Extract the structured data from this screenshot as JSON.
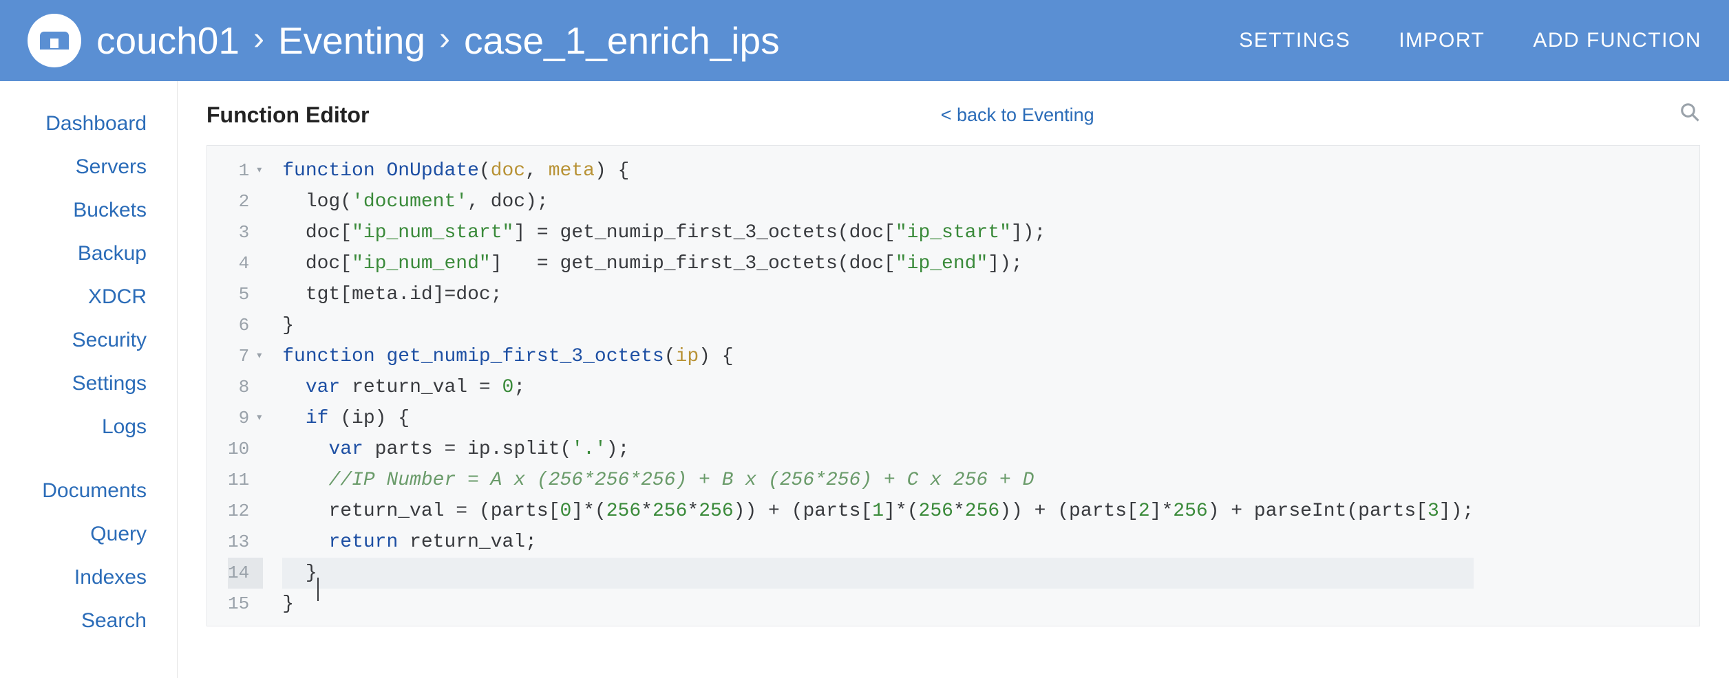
{
  "header": {
    "breadcrumb": [
      "couch01",
      "Eventing",
      "case_1_enrich_ips"
    ],
    "actions": [
      "SETTINGS",
      "IMPORT",
      "ADD FUNCTION"
    ]
  },
  "sidebar": {
    "group1": [
      "Dashboard",
      "Servers",
      "Buckets",
      "Backup",
      "XDCR",
      "Security",
      "Settings",
      "Logs"
    ],
    "group2": [
      "Documents",
      "Query",
      "Indexes",
      "Search"
    ]
  },
  "main": {
    "title": "Function Editor",
    "back_link": "< back to Eventing"
  },
  "editor": {
    "active_line": 14,
    "fold_lines": [
      1,
      7,
      9
    ],
    "lines": [
      [
        {
          "t": "k",
          "v": "function"
        },
        {
          "t": "p",
          "v": " "
        },
        {
          "t": "fn",
          "v": "OnUpdate"
        },
        {
          "t": "p",
          "v": "("
        },
        {
          "t": "arg",
          "v": "doc"
        },
        {
          "t": "p",
          "v": ", "
        },
        {
          "t": "arg",
          "v": "meta"
        },
        {
          "t": "p",
          "v": ") {"
        }
      ],
      [
        {
          "t": "p",
          "v": "  "
        },
        {
          "t": "id",
          "v": "log"
        },
        {
          "t": "p",
          "v": "("
        },
        {
          "t": "s",
          "v": "'document'"
        },
        {
          "t": "p",
          "v": ", "
        },
        {
          "t": "id",
          "v": "doc"
        },
        {
          "t": "p",
          "v": ");"
        }
      ],
      [
        {
          "t": "p",
          "v": "  "
        },
        {
          "t": "id",
          "v": "doc"
        },
        {
          "t": "p",
          "v": "["
        },
        {
          "t": "s",
          "v": "\"ip_num_start\""
        },
        {
          "t": "p",
          "v": "] = "
        },
        {
          "t": "id",
          "v": "get_numip_first_3_octets"
        },
        {
          "t": "p",
          "v": "("
        },
        {
          "t": "id",
          "v": "doc"
        },
        {
          "t": "p",
          "v": "["
        },
        {
          "t": "s",
          "v": "\"ip_start\""
        },
        {
          "t": "p",
          "v": "]);"
        }
      ],
      [
        {
          "t": "p",
          "v": "  "
        },
        {
          "t": "id",
          "v": "doc"
        },
        {
          "t": "p",
          "v": "["
        },
        {
          "t": "s",
          "v": "\"ip_num_end\""
        },
        {
          "t": "p",
          "v": "]   = "
        },
        {
          "t": "id",
          "v": "get_numip_first_3_octets"
        },
        {
          "t": "p",
          "v": "("
        },
        {
          "t": "id",
          "v": "doc"
        },
        {
          "t": "p",
          "v": "["
        },
        {
          "t": "s",
          "v": "\"ip_end\""
        },
        {
          "t": "p",
          "v": "]);"
        }
      ],
      [
        {
          "t": "p",
          "v": "  "
        },
        {
          "t": "id",
          "v": "tgt"
        },
        {
          "t": "p",
          "v": "["
        },
        {
          "t": "id",
          "v": "meta"
        },
        {
          "t": "p",
          "v": "."
        },
        {
          "t": "id",
          "v": "id"
        },
        {
          "t": "p",
          "v": "]="
        },
        {
          "t": "id",
          "v": "doc"
        },
        {
          "t": "p",
          "v": ";"
        }
      ],
      [
        {
          "t": "p",
          "v": "}"
        }
      ],
      [
        {
          "t": "k",
          "v": "function"
        },
        {
          "t": "p",
          "v": " "
        },
        {
          "t": "fn",
          "v": "get_numip_first_3_octets"
        },
        {
          "t": "p",
          "v": "("
        },
        {
          "t": "arg",
          "v": "ip"
        },
        {
          "t": "p",
          "v": ") {"
        }
      ],
      [
        {
          "t": "p",
          "v": "  "
        },
        {
          "t": "k",
          "v": "var"
        },
        {
          "t": "p",
          "v": " "
        },
        {
          "t": "id",
          "v": "return_val"
        },
        {
          "t": "p",
          "v": " = "
        },
        {
          "t": "n",
          "v": "0"
        },
        {
          "t": "p",
          "v": ";"
        }
      ],
      [
        {
          "t": "p",
          "v": "  "
        },
        {
          "t": "k",
          "v": "if"
        },
        {
          "t": "p",
          "v": " ("
        },
        {
          "t": "id",
          "v": "ip"
        },
        {
          "t": "p",
          "v": ") {"
        }
      ],
      [
        {
          "t": "p",
          "v": "    "
        },
        {
          "t": "k",
          "v": "var"
        },
        {
          "t": "p",
          "v": " "
        },
        {
          "t": "id",
          "v": "parts"
        },
        {
          "t": "p",
          "v": " = "
        },
        {
          "t": "id",
          "v": "ip"
        },
        {
          "t": "p",
          "v": "."
        },
        {
          "t": "id",
          "v": "split"
        },
        {
          "t": "p",
          "v": "("
        },
        {
          "t": "s",
          "v": "'.'"
        },
        {
          "t": "p",
          "v": ");"
        }
      ],
      [
        {
          "t": "p",
          "v": "    "
        },
        {
          "t": "cm",
          "v": "//IP Number = A x (256*256*256) + B x (256*256) + C x 256 + D"
        }
      ],
      [
        {
          "t": "p",
          "v": "    "
        },
        {
          "t": "id",
          "v": "return_val"
        },
        {
          "t": "p",
          "v": " = ("
        },
        {
          "t": "id",
          "v": "parts"
        },
        {
          "t": "p",
          "v": "["
        },
        {
          "t": "n",
          "v": "0"
        },
        {
          "t": "p",
          "v": "]*( "
        },
        {
          "t": "n",
          "v": "256"
        },
        {
          "t": "p",
          "v": "*"
        },
        {
          "t": "n",
          "v": "256"
        },
        {
          "t": "p",
          "v": "*"
        },
        {
          "t": "n",
          "v": "256"
        },
        {
          "t": "p",
          "v": ")) + ("
        },
        {
          "t": "id",
          "v": "parts"
        },
        {
          "t": "p",
          "v": "["
        },
        {
          "t": "n",
          "v": "1"
        },
        {
          "t": "p",
          "v": "]*( "
        },
        {
          "t": "n",
          "v": "256"
        },
        {
          "t": "p",
          "v": "*"
        },
        {
          "t": "n",
          "v": "256"
        },
        {
          "t": "p",
          "v": ")) + ("
        },
        {
          "t": "id",
          "v": "parts"
        },
        {
          "t": "p",
          "v": "["
        },
        {
          "t": "n",
          "v": "2"
        },
        {
          "t": "p",
          "v": "]*"
        },
        {
          "t": "n",
          "v": "256"
        },
        {
          "t": "p",
          "v": ") + "
        },
        {
          "t": "id",
          "v": "parseInt"
        },
        {
          "t": "p",
          "v": "("
        },
        {
          "t": "id",
          "v": "parts"
        },
        {
          "t": "p",
          "v": "["
        },
        {
          "t": "n",
          "v": "3"
        },
        {
          "t": "p",
          "v": "]);"
        }
      ],
      [
        {
          "t": "p",
          "v": "    "
        },
        {
          "t": "k",
          "v": "return"
        },
        {
          "t": "p",
          "v": " "
        },
        {
          "t": "id",
          "v": "return_val"
        },
        {
          "t": "p",
          "v": ";"
        }
      ],
      [
        {
          "t": "p",
          "v": "  }"
        },
        {
          "t": "cursor",
          "v": ""
        }
      ],
      [
        {
          "t": "p",
          "v": "}"
        }
      ]
    ]
  }
}
